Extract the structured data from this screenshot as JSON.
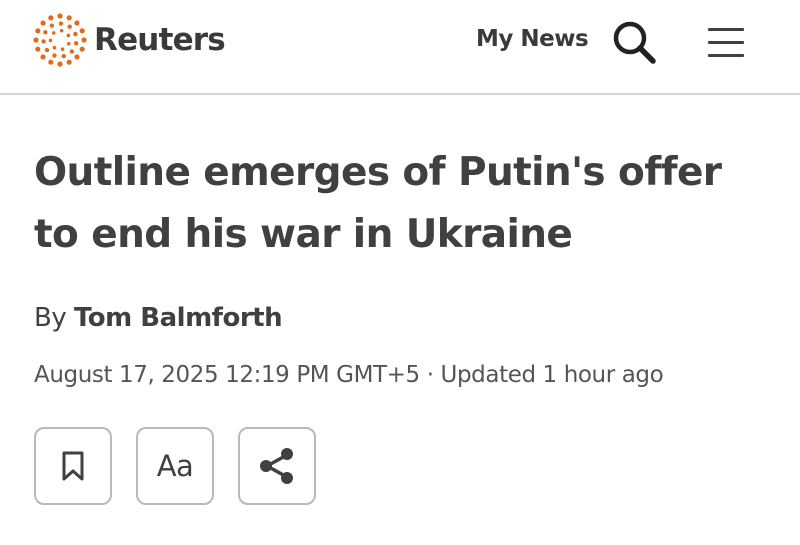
{
  "header": {
    "brand": "Reuters",
    "my_news_label": "My News",
    "brand_color": "#e26a1b",
    "icons": {
      "search": "search-icon",
      "menu": "hamburger-menu-icon"
    }
  },
  "article": {
    "headline": "Outline emerges of Putin's offer to end his war in Ukraine",
    "byline_prefix": "By",
    "author": "Tom Balmforth",
    "date": "August 17, 2025 12:19 PM GMT+5",
    "separator": "·",
    "updated": "Updated 1 hour ago"
  },
  "tools": {
    "bookmark_icon": "bookmark-icon",
    "text_size_label": "Aa",
    "share_icon": "share-icon"
  }
}
